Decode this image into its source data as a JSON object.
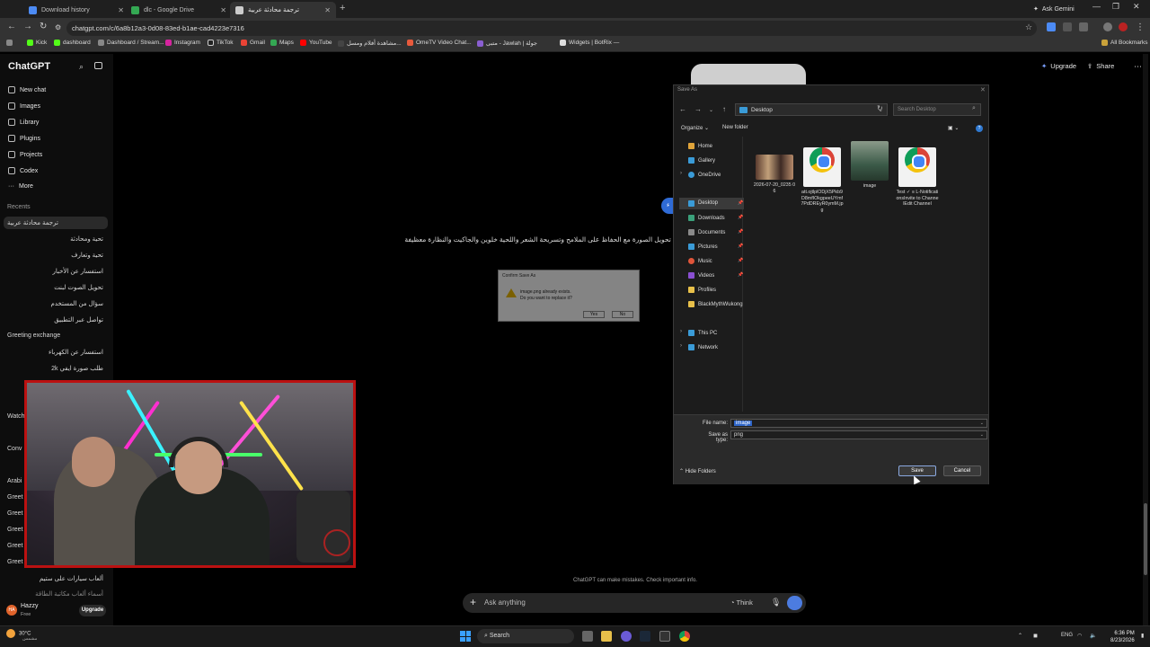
{
  "browser": {
    "tabs": [
      {
        "label": "Download history",
        "color": "#4c8bf5"
      },
      {
        "label": "dlc - Google Drive",
        "color": "#34a853"
      },
      {
        "label": "ترجمة محادثة عربية",
        "color": "#cccccc"
      }
    ],
    "new_tab": "+",
    "ask_gemini": "Ask Gemini",
    "url": "chatgpt.com/c/6a8b12a3-0d08-83ed-b1ae-cad4223e7316",
    "bookmarks": [
      "Kick",
      "dashboard",
      "Dashboard / Stream...",
      "Instagram",
      "TikTok",
      "Gmail",
      "Maps",
      "YouTube",
      "مشاهدة أفلام ومسل...",
      "OmeTV Video Chat...",
      "متبی - Jawlah | جولة",
      "Widgets | BotRix —"
    ],
    "all_bookmarks": "All Bookmarks"
  },
  "sidebar": {
    "app_title": "ChatGPT",
    "nav": [
      {
        "label": "New chat",
        "icon": "edit-icon"
      },
      {
        "label": "Images",
        "icon": "image-icon"
      },
      {
        "label": "Library",
        "icon": "library-icon"
      },
      {
        "label": "Plugins",
        "icon": "plugin-icon"
      },
      {
        "label": "Projects",
        "icon": "folder-icon"
      },
      {
        "label": "Codex",
        "icon": "code-icon"
      },
      {
        "label": "More",
        "icon": "more-icon"
      }
    ],
    "recents_heading": "Recents",
    "recents": [
      "ترجمة محادثة عربية",
      "تحية ومحادثة",
      "تحية وتعارف",
      "استفسار عن الأخبار",
      "تحويل الصوت لبنت",
      "سؤال من المستخدم",
      "تواصل عبر التطبيق",
      "Greeting exchange",
      "استفسار عن الكهرباء",
      "طلب صورة ايفي 2k"
    ],
    "partial_items": [
      "Watch",
      "Conv",
      "Arabi",
      "Greet",
      "Greet",
      "Greet",
      "Greet",
      "Greet"
    ],
    "bottom_items": [
      "ألعاب سيارات على ستيم",
      "أسماء ألعاب مكاتبة الطاقة"
    ],
    "user_name": "Hazzy",
    "user_plan": "Free",
    "user_initials": "HA",
    "upgrade": "Upgrade"
  },
  "chat": {
    "top_upgrade": "Upgrade",
    "top_share": "Share",
    "user_chip": "ء",
    "assistant_line": "تم تحويل الصورة مع الحفاظ على الملامح وتسريحة الشعر واللحية خلوين والجاكيت والنظارة معظيفة",
    "disclaimer": "ChatGPT can make mistakes. Check important info.",
    "composer_placeholder": "Ask anything",
    "think": "Think",
    "plus": "+"
  },
  "confirm_dialog": {
    "title": "Confirm Save As",
    "line1": "image.png already exists.",
    "line2": "Do you want to replace it?",
    "yes": "Yes",
    "no": "No"
  },
  "save_dialog": {
    "title": "Save As",
    "location": "Desktop",
    "search_placeholder": "Search Desktop",
    "organize": "Organize",
    "new_folder": "New folder",
    "nav": [
      {
        "label": "Home",
        "icon": "home-icon",
        "color": "#e0a43a"
      },
      {
        "label": "Gallery",
        "icon": "gallery-icon",
        "color": "#3a9bd7"
      },
      {
        "label": "OneDrive",
        "icon": "cloud-icon",
        "color": "#3a9bd7"
      },
      {
        "label": "Desktop",
        "icon": "desktop-icon",
        "color": "#3a9bd7"
      },
      {
        "label": "Downloads",
        "icon": "download-icon",
        "color": "#3aa07a"
      },
      {
        "label": "Documents",
        "icon": "document-icon",
        "color": "#8a8a8a"
      },
      {
        "label": "Pictures",
        "icon": "picture-icon",
        "color": "#3a9bd7"
      },
      {
        "label": "Music",
        "icon": "music-icon",
        "color": "#e0553a"
      },
      {
        "label": "Videos",
        "icon": "video-icon",
        "color": "#8a4fd1"
      },
      {
        "label": "Profiles",
        "icon": "folder-icon",
        "color": "#e8c04a"
      },
      {
        "label": "BlackMythWukong",
        "icon": "folder-icon",
        "color": "#e8c04a"
      },
      {
        "label": "This PC",
        "icon": "pc-icon",
        "color": "#3a9bd7"
      },
      {
        "label": "Network",
        "icon": "network-icon",
        "color": "#3a9bd7"
      }
    ],
    "files": [
      {
        "name": "2026-07-20_0235 06",
        "kind": "photo"
      },
      {
        "name": "att.ojtlplODjX5Pkb9D8mfIOkgpeeUYmf7PdDREyR0ymM.jpg",
        "kind": "chrome"
      },
      {
        "name": "image",
        "kind": "portrait"
      },
      {
        "name": "Test ✓ ≡ L-NotificationsInvite to ChannelEdit Channel",
        "kind": "chrome"
      }
    ],
    "file_name_label": "File name:",
    "file_name_value": "image",
    "type_label": "Save as type:",
    "type_value": "png",
    "hide_folders": "Hide Folders",
    "save": "Save",
    "cancel": "Cancel"
  },
  "taskbar": {
    "temp": "30°C",
    "weather": "مشمس",
    "search": "Search",
    "lang": "ENG",
    "time": "6:36 PM",
    "date": "8/23/2026"
  }
}
